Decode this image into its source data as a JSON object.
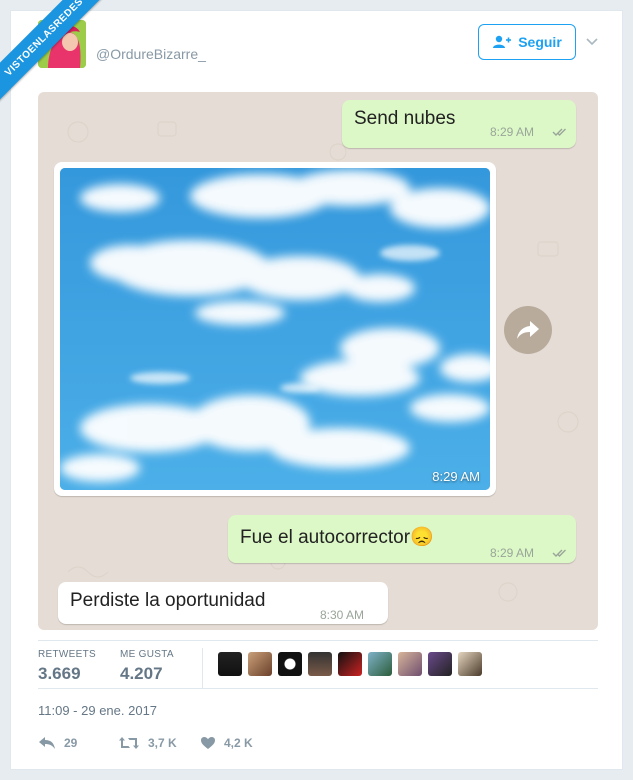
{
  "watermark": "VISTOENLASREDES",
  "author": {
    "handle": "@OrdureBizarre_"
  },
  "follow_button": {
    "label": "Seguir"
  },
  "chat": {
    "messages": [
      {
        "from": "out",
        "text": "Send nubes",
        "time": "8:29 AM"
      },
      {
        "from": "in",
        "image": "sky-with-clouds",
        "time": "8:29 AM"
      },
      {
        "from": "out",
        "text": "Fue el autocorrector",
        "emoji": "😞",
        "time": "8:29 AM"
      },
      {
        "from": "in",
        "text": "Perdiste la oportunidad",
        "time": "8:30 AM"
      }
    ]
  },
  "stats": {
    "retweets_label": "RETWEETS",
    "retweets_value": "3.669",
    "likes_label": "ME GUSTA",
    "likes_value": "4.207"
  },
  "date": "11:09 - 29 ene. 2017",
  "actions": {
    "reply_count": "29",
    "retweet_count": "3,7 K",
    "like_count": "4,2 K"
  },
  "colors": {
    "accent": "#1da1f2",
    "outgoing_bubble": "#dcf8c6",
    "chat_bg": "#e5ddd5",
    "ribbon": "#1b95e0"
  }
}
